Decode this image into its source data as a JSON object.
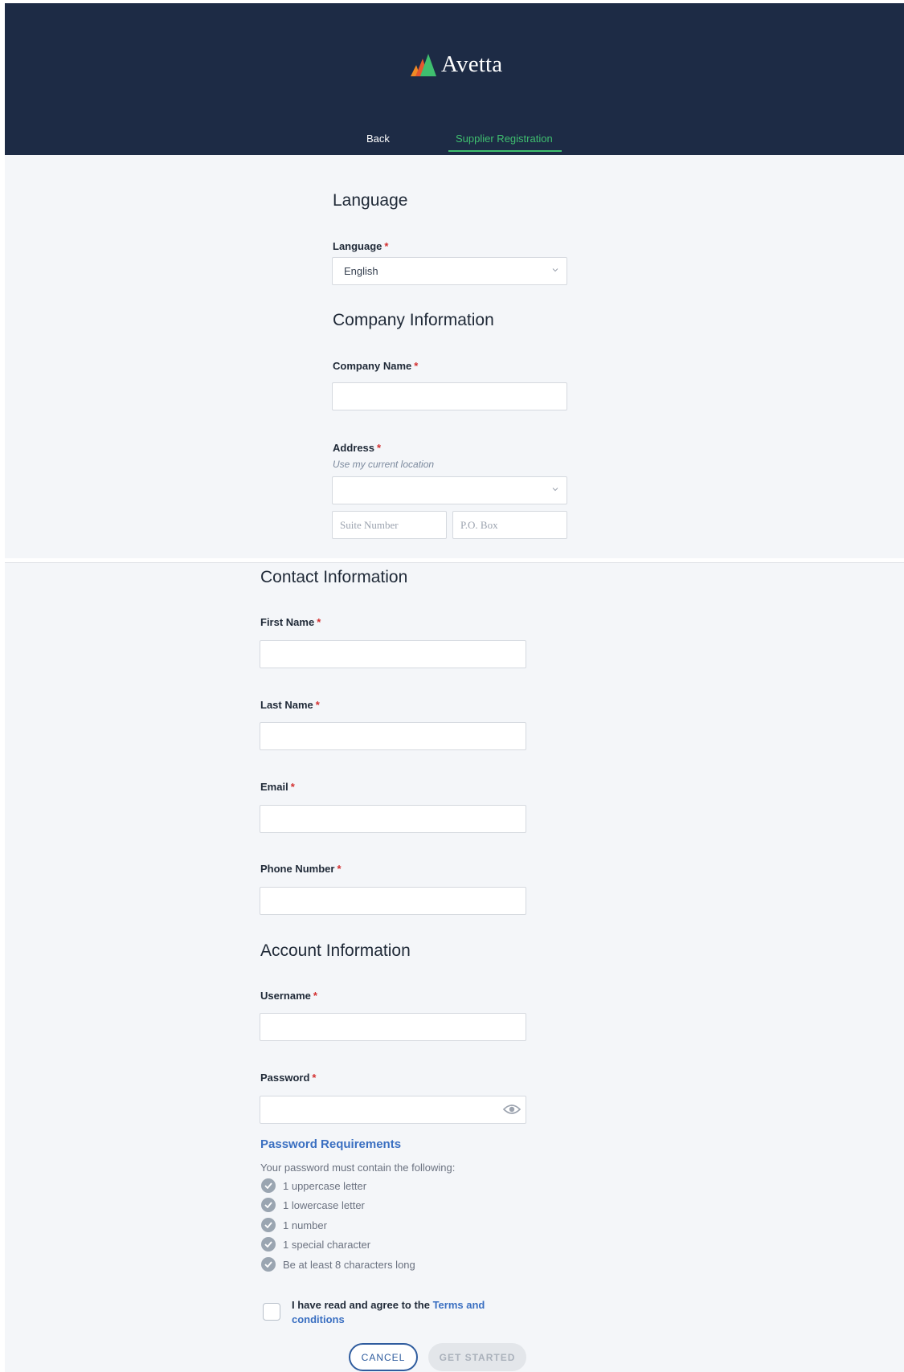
{
  "header": {
    "logo_text": "Avetta",
    "nav_back": "Back",
    "nav_registration": "Supplier Registration",
    "accent_color": "#3fbf6f",
    "background_color": "#1d2b45"
  },
  "language_section": {
    "title": "Language",
    "field_label": "Language",
    "selected_value": "English"
  },
  "company_section": {
    "title": "Company Information",
    "company_name_label": "Company Name",
    "address_label": "Address",
    "location_hint": "Use my current location",
    "suite_placeholder": "Suite Number",
    "po_box_placeholder": "P.O. Box"
  },
  "contact_section": {
    "title": "Contact Information",
    "first_name_label": "First Name",
    "last_name_label": "Last Name",
    "email_label": "Email",
    "phone_label": "Phone Number"
  },
  "account_section": {
    "title": "Account Information",
    "username_label": "Username",
    "password_label": "Password"
  },
  "password_requirements": {
    "title": "Password Requirements",
    "intro": "Your password must contain the following:",
    "items": [
      "1 uppercase letter",
      "1 lowercase letter",
      "1 number",
      "1 special character",
      "Be at least 8 characters long"
    ]
  },
  "agreement": {
    "text": "I have read and agree to the ",
    "link_text": "Terms and conditions"
  },
  "buttons": {
    "cancel": "CANCEL",
    "get_started": "GET STARTED"
  },
  "required_marker": "*"
}
